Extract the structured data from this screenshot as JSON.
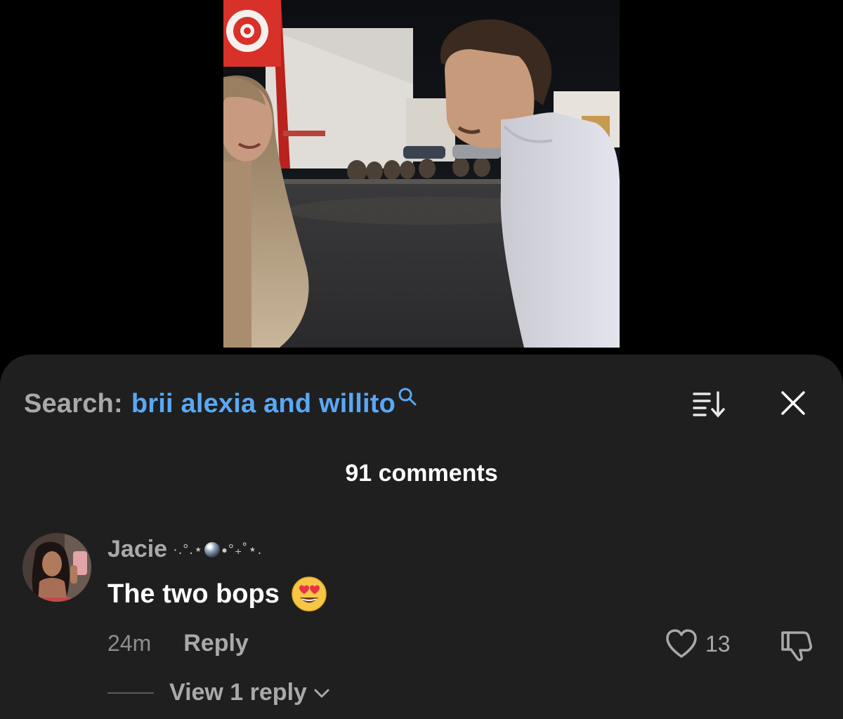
{
  "video": {
    "description_icon": "video-frame"
  },
  "comments_panel": {
    "search_label": "Search:",
    "search_query": "brii alexia and willito",
    "search_icon": "search-icon",
    "sort_icon": "sort-icon",
    "close_icon": "close-icon",
    "comment_count": "91 comments"
  },
  "comment": {
    "username": "Jacie",
    "username_decoration_left": "·.°.⋆",
    "username_decoration_right": "°₊˚⋆.",
    "text": "The two bops",
    "emoji": "heart-eyes-emoji",
    "timestamp": "24m",
    "reply_label": "Reply",
    "like_count": "13",
    "like_icon": "heart-icon",
    "dislike_icon": "thumbs-down-icon",
    "view_replies_label": "View 1 reply",
    "view_replies_icon": "chevron-down-icon"
  },
  "colors": {
    "background": "#000000",
    "sheet": "#1f1f1f",
    "search_query": "#5aa8f5",
    "muted_text": "#a9a9a9",
    "primary_text": "#ffffff"
  }
}
